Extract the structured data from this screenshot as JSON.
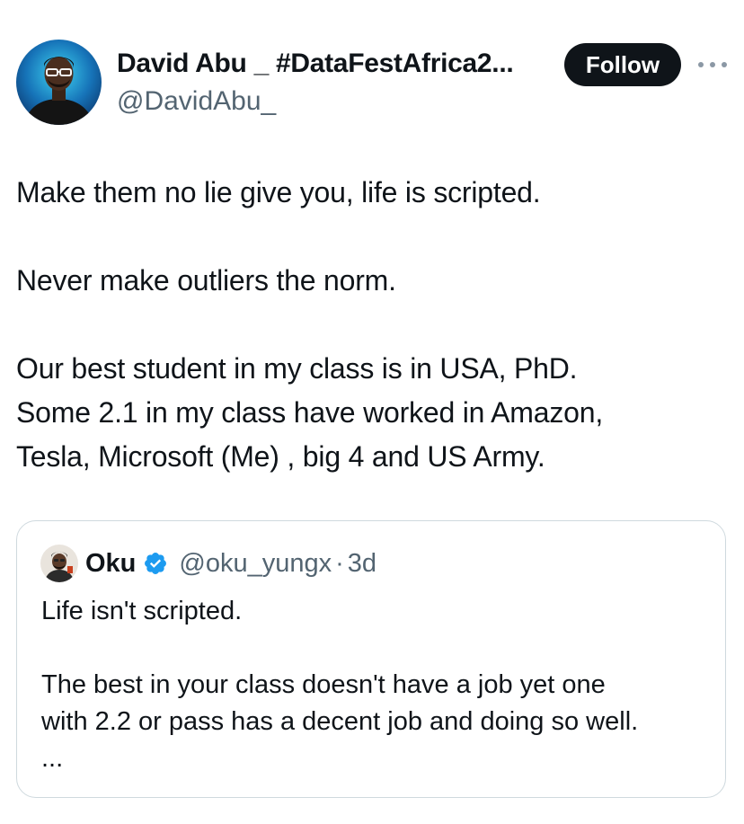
{
  "author": {
    "name": "David Abu _ #DataFestAfrica2...",
    "handle": "@DavidAbu_"
  },
  "header": {
    "follow_label": "Follow"
  },
  "tweet": {
    "paragraphs": [
      "Make them no lie give you, life is scripted.",
      "Never make outliers the norm.",
      "Our best student in my class is in USA, PhD.",
      "Some 2.1 in my class have worked in Amazon,",
      "Tesla, Microsoft (Me) , big 4 and US Army."
    ]
  },
  "quote": {
    "name": "Oku",
    "handle": "@oku_yungx",
    "separator": "·",
    "time": "3d",
    "lines": [
      "Life isn't scripted.",
      "The best in your class doesn't have a job yet one",
      "with 2.2 or pass has a decent job and doing so well.",
      "..."
    ]
  },
  "icons": {
    "more": "more-horizontal-icon",
    "verified": "verified-badge-icon"
  },
  "colors": {
    "text": "#0f1419",
    "secondary_text": "#536471",
    "follow_button": "#0f1419",
    "verified": "#1d9bf0",
    "card_border": "#cfd9de"
  }
}
